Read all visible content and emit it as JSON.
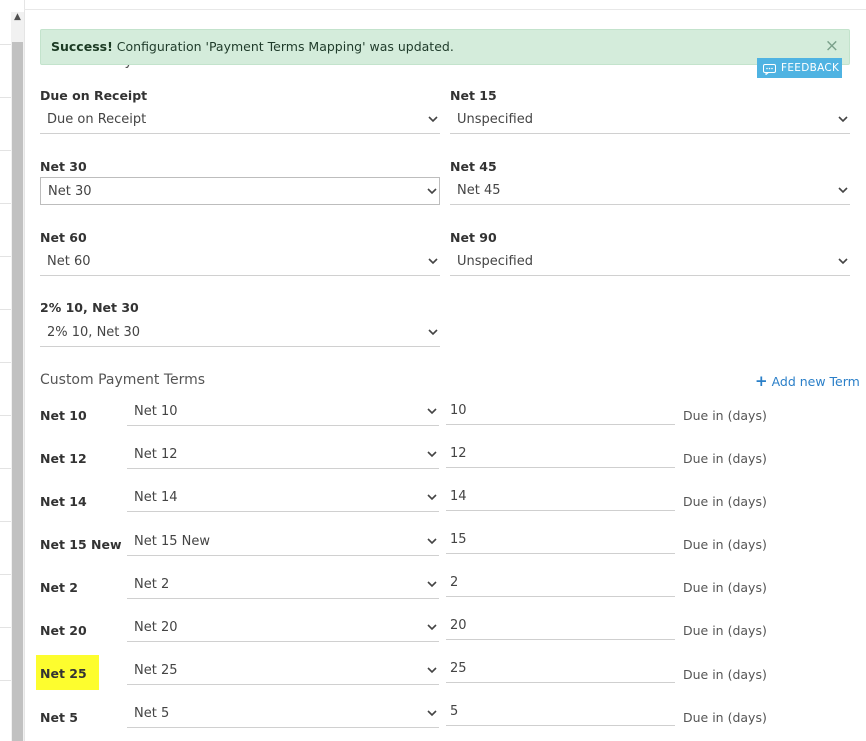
{
  "alert": {
    "strong": "Success!",
    "message": "Configuration 'Payment Terms Mapping' was updated.",
    "close": "×"
  },
  "feedback": {
    "label": "FEEDBACK"
  },
  "standard": {
    "title": "Standard Payment Terms",
    "fields": [
      {
        "label": "Due on Receipt",
        "value": "Due on Receipt"
      },
      {
        "label": "Net 15",
        "value": "Unspecified"
      },
      {
        "label": "Net 30",
        "value": "Net 30"
      },
      {
        "label": "Net 45",
        "value": "Net 45"
      },
      {
        "label": "Net 60",
        "value": "Net 60"
      },
      {
        "label": "Net 90",
        "value": "Unspecified"
      },
      {
        "label": "2% 10, Net 30",
        "value": "2% 10, Net 30"
      }
    ]
  },
  "custom": {
    "title": "Custom Payment Terms",
    "add_label": "Add new Term",
    "due_label": "Due in (days)",
    "rows": [
      {
        "label": "Net 10",
        "select": "Net 10",
        "days": "10"
      },
      {
        "label": "Net 12",
        "select": "Net 12",
        "days": "12"
      },
      {
        "label": "Net 14",
        "select": "Net 14",
        "days": "14"
      },
      {
        "label": "Net 15 New",
        "select": "Net 15 New",
        "days": "15"
      },
      {
        "label": "Net 2",
        "select": "Net 2",
        "days": "2"
      },
      {
        "label": "Net 20",
        "select": "Net 20",
        "days": "20"
      },
      {
        "label": "Net 25",
        "select": "Net 25",
        "days": "25"
      },
      {
        "label": "Net 5",
        "select": "Net 5",
        "days": "5"
      }
    ]
  },
  "icons": {
    "dropdown": "chevron-down-icon",
    "close": "close-icon",
    "feedback": "chat-icon",
    "add": "plus-icon",
    "scroll": "arrow-up-icon"
  },
  "colors": {
    "success_bg": "#d4ecdb",
    "feedback_bg": "#4fb3e2",
    "link": "#2a7fc8",
    "highlight": "#fdfd2e"
  }
}
